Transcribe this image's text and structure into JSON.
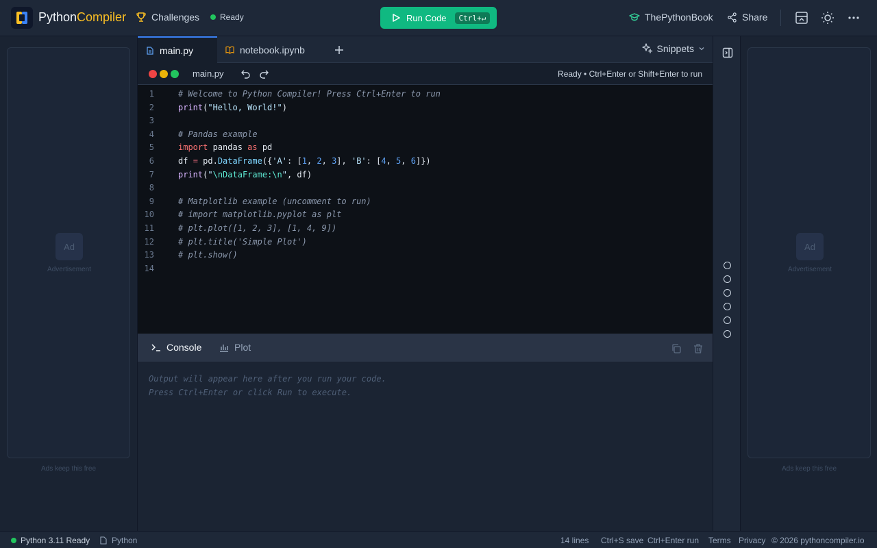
{
  "header": {
    "brand_part1": "Python",
    "brand_part2": "Compiler",
    "challenges_label": "Challenges",
    "status_label": "Ready",
    "run_label": "Run Code",
    "run_shortcut": "Ctrl+↵",
    "book_label": "ThePythonBook",
    "share_label": "Share"
  },
  "tabs": [
    {
      "label": "main.py",
      "icon": "file-icon",
      "active": true
    },
    {
      "label": "notebook.ipynb",
      "icon": "notebook-icon",
      "active": false
    }
  ],
  "snippets_label": "Snippets",
  "filebar": {
    "filename": "main.py",
    "hint": "Ready • Ctrl+Enter or Shift+Enter to run"
  },
  "editor": {
    "line_numbers": [
      "1",
      "2",
      "3",
      "4",
      "5",
      "6",
      "7",
      "8",
      "9",
      "10",
      "11",
      "12",
      "13",
      "14"
    ]
  },
  "console": {
    "tab_console": "Console",
    "tab_plot": "Plot",
    "output_line1": "Output will appear here after you run your code.",
    "output_line2": "Press Ctrl+Enter or click Run to execute."
  },
  "ads": {
    "badge": "Ad",
    "label": "Advertisement",
    "footer": "Ads keep this free"
  },
  "statusbar": {
    "python_status": "Python 3.11 Ready",
    "language": "Python",
    "lines": "14 lines",
    "save_hint": "Ctrl+S save",
    "run_hint": "Ctrl+Enter run",
    "terms": "Terms",
    "privacy": "Privacy",
    "copyright": "© 2026 pythoncompiler.io"
  },
  "colors": {
    "accent_green": "#10b981",
    "brand_yellow": "#fbbf24",
    "status_green": "#22c55e",
    "tab_active_border": "#3b82f6"
  }
}
